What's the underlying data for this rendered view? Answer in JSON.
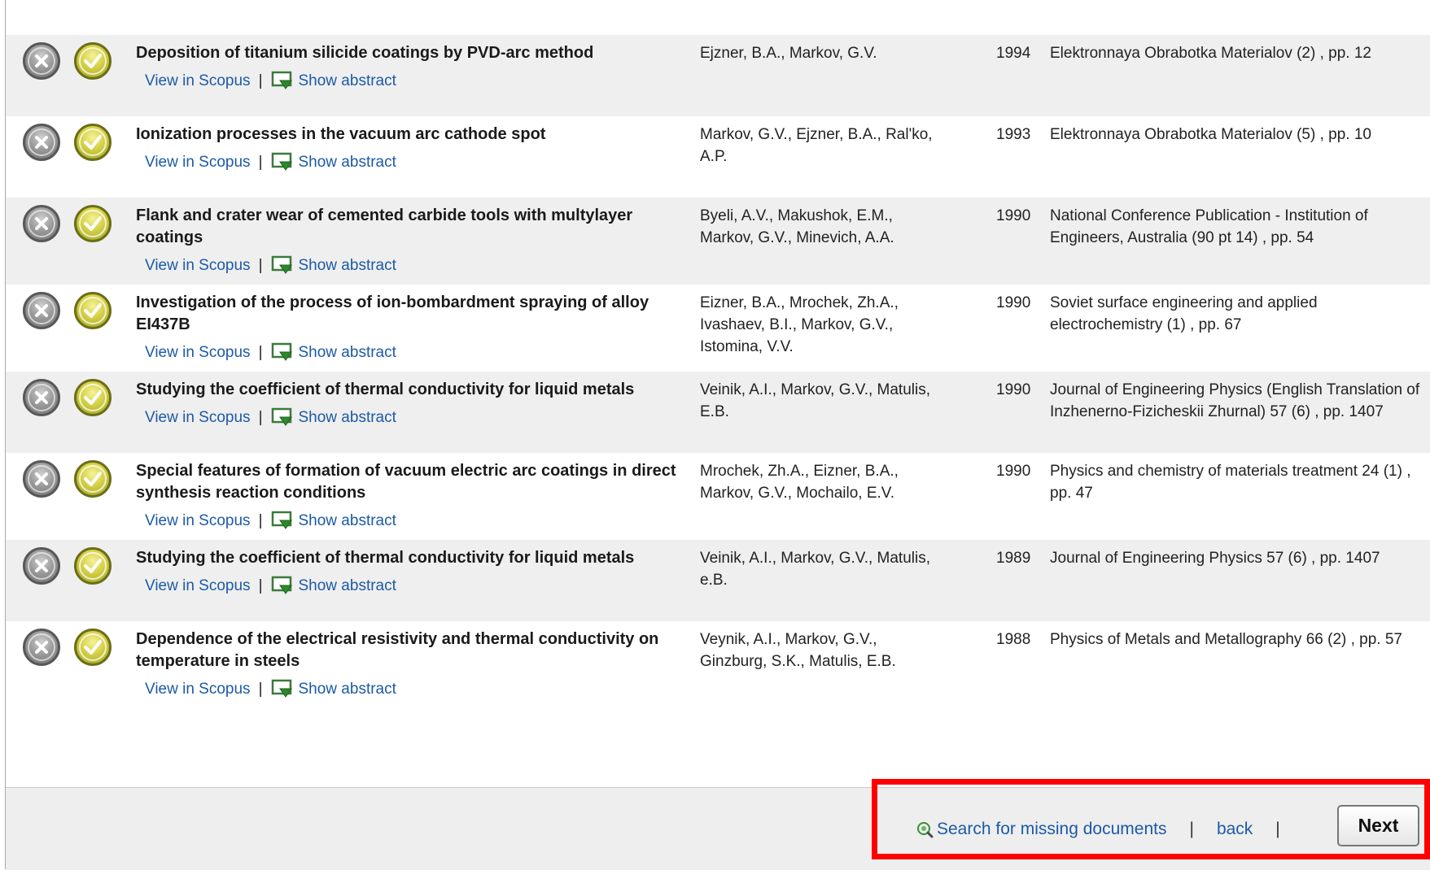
{
  "results": [
    {
      "title": "Deposition of titanium silicide coatings by PVD-arc method",
      "authors": "Ejzner, B.A., Markov, G.V.",
      "year": "1994",
      "source": "Elektronnaya Obrabotka Materialov (2) , pp. 12"
    },
    {
      "title": "Ionization processes in the vacuum arc cathode spot",
      "authors": "Markov, G.V., Ejzner, B.A., Ral'ko, A.P.",
      "year": "1993",
      "source": "Elektronnaya Obrabotka Materialov (5) , pp. 10"
    },
    {
      "title": "Flank and crater wear of cemented carbide tools with multylayer coatings",
      "authors": "Byeli, A.V., Makushok, E.M., Markov, G.V., Minevich, A.A.",
      "year": "1990",
      "source": "National Conference Publication - Institution of Engineers, Australia (90 pt 14) , pp. 54"
    },
    {
      "title": "Investigation of the process of ion-bombardment spraying of alloy EI437B",
      "authors": "Eizner, B.A., Mrochek, Zh.A., Ivashaev, B.I., Markov, G.V., Istomina, V.V.",
      "year": "1990",
      "source": "Soviet surface engineering and applied electrochemistry (1) , pp. 67"
    },
    {
      "title": "Studying the coefficient of thermal conductivity for liquid metals",
      "authors": "Veinik, A.I., Markov, G.V., Matulis, E.B.",
      "year": "1990",
      "source": "Journal of Engineering Physics (English Translation of Inzhenerno-Fizicheskii Zhurnal) 57 (6) , pp. 1407"
    },
    {
      "title": "Special features of formation of vacuum electric arc coatings in direct synthesis reaction conditions",
      "authors": "Mrochek, Zh.A., Eizner, B.A., Markov, G.V., Mochailo, E.V.",
      "year": "1990",
      "source": "Physics and chemistry of materials treatment 24 (1) , pp. 47"
    },
    {
      "title": "Studying the coefficient of thermal conductivity for liquid metals",
      "authors": "Veinik, A.I., Markov, G.V., Matulis, e.B.",
      "year": "1989",
      "source": "Journal of Engineering Physics 57 (6) , pp. 1407"
    },
    {
      "title": "Dependence of the electrical resistivity and thermal conductivity on temperature in steels",
      "authors": "Veynik, A.I., Markov, G.V., Ginzburg, S.K., Matulis, E.B.",
      "year": "1988",
      "source": "Physics of Metals and Metallography 66 (2) , pp. 57"
    }
  ],
  "row_links": {
    "view": "View in Scopus",
    "separator": "|",
    "abstract": "Show abstract"
  },
  "footer": {
    "search_missing": "Search for missing documents",
    "separator": "|",
    "back": "back",
    "next": "Next"
  },
  "icons": {
    "reject": "close-circle-icon",
    "accept": "checkmark-circle-icon",
    "abstract": "show-abstract-icon",
    "search": "magnifier-icon"
  },
  "colors": {
    "link": "#1c5aa6",
    "row_alt": "#efefef",
    "highlight": "#ff0000"
  }
}
